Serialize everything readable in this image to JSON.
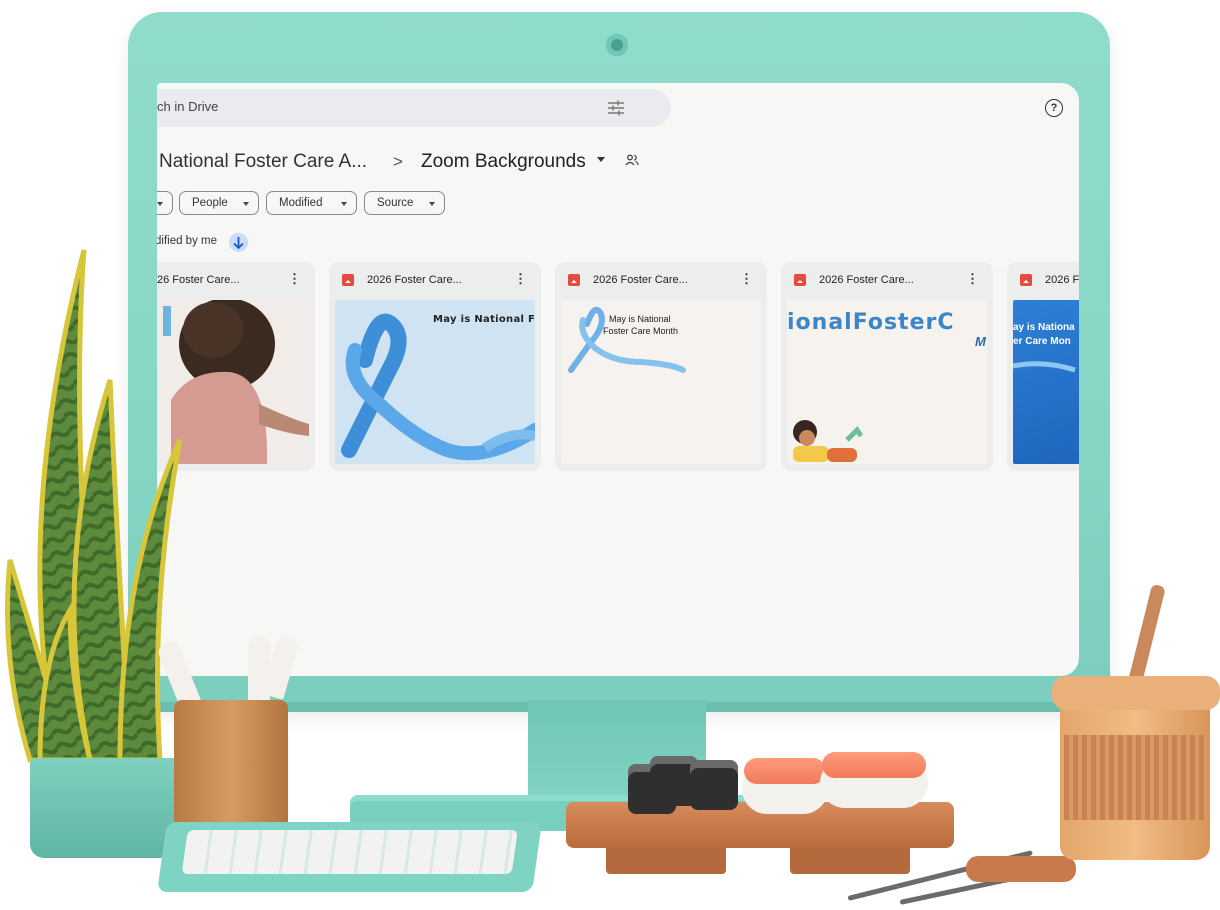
{
  "drive": {
    "search_placeholder": "ch in Drive",
    "help_glyph": "?",
    "breadcrumb": {
      "parent": "National Foster Care A...",
      "separator": ">",
      "current": "Zoom Backgrounds"
    },
    "filters": [
      "People",
      "Modified",
      "Source"
    ],
    "sort_label": "dified by me",
    "cards": [
      {
        "title": "26 Foster Care...",
        "thumb": "girl-photo"
      },
      {
        "title": "2026 Foster Care...",
        "thumb_text": "May is National Fo"
      },
      {
        "title": "2026 Foster Care...",
        "thumb_text_1": "May is National",
        "thumb_text_2": "Foster Care Month"
      },
      {
        "title": "2026 Foster Care...",
        "thumb_text_1": "ionalFosterC",
        "thumb_text_2": "M"
      },
      {
        "title": "2026 F",
        "thumb_text_1": "ay is Nationa",
        "thumb_text_2": "er Care Mon"
      }
    ]
  },
  "colors": {
    "monitor": "#86d6c6",
    "screen_bg": "#f7f7f5",
    "card_bg": "#eceeee",
    "ribbon_blue": "#4a9be0",
    "file_icon_red": "#e24b3d"
  },
  "icons": [
    "help-circle-icon",
    "tune-icon",
    "shared-folder-icon",
    "chevron-down-icon",
    "arrow-down-icon",
    "image-file-icon",
    "more-vert-icon"
  ]
}
